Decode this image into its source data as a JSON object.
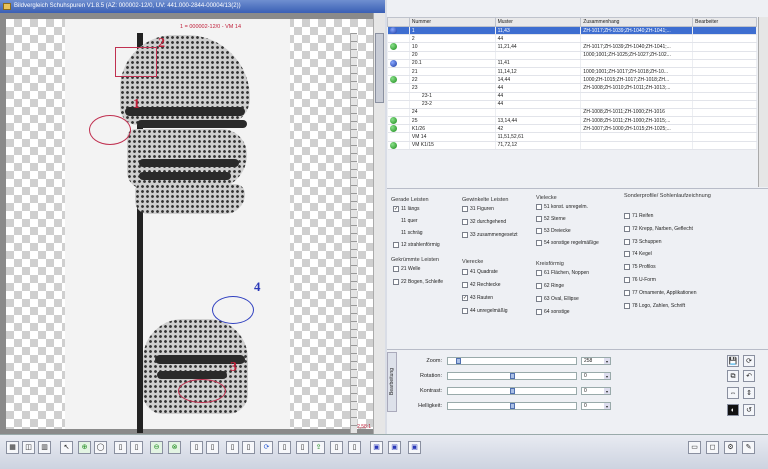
{
  "window": {
    "title": "Bildvergleich Schuhspuren V1.8.5 (AZ: 000002-12/0, UV: 441.000-2844-00004/13(2))"
  },
  "viewer": {
    "header": "1 = 000002-12/0 - VM 14",
    "zoom": "2,58:1",
    "markers": {
      "m1": "1",
      "m2": "2",
      "m3": "3",
      "m4": "4"
    }
  },
  "grid": {
    "columns": [
      "",
      "Nummer",
      "Muster",
      "Zusammenhang",
      "Bearbeiter"
    ],
    "rows": [
      {
        "status": "blue",
        "nummer": "1",
        "muster": "11,43",
        "zusammenhang": "ZH-1017;ZH-1039;ZH-1040;ZH-1041;...",
        "selected": true
      },
      {
        "status": "",
        "nummer": "2",
        "muster": "44",
        "zusammenhang": ""
      },
      {
        "status": "green",
        "nummer": "10",
        "muster": "11,21,44",
        "zusammenhang": "ZH-1017;ZH-1039;ZH-1040;ZH-1041;..."
      },
      {
        "status": "",
        "nummer": "20",
        "muster": "",
        "zusammenhang": "1000;1001;ZH-1025;ZH-1027;ZH-102..."
      },
      {
        "status": "blue",
        "nummer": "20.1",
        "muster": "11,41",
        "zusammenhang": ""
      },
      {
        "status": "",
        "nummer": "21",
        "muster": "11,14,12",
        "zusammenhang": "1000;1001;ZH-1017;ZH-1018;ZH-10..."
      },
      {
        "status": "green",
        "nummer": "22",
        "muster": "14,44",
        "zusammenhang": "1000;ZH-1015;ZH-1017;ZH-1018;ZH..."
      },
      {
        "status": "",
        "nummer": "23",
        "muster": "44",
        "zusammenhang": "ZH-1008;ZH-1010;ZH-1011;ZH-1013;..."
      },
      {
        "status": "",
        "nummer": "23-1",
        "muster": "44",
        "zusammenhang": "",
        "indent": true
      },
      {
        "status": "",
        "nummer": "23-2",
        "muster": "44",
        "zusammenhang": "",
        "indent": true
      },
      {
        "status": "",
        "nummer": "24",
        "muster": "",
        "zusammenhang": "ZH-1008;ZH-1011;ZH-1000;ZH-1016"
      },
      {
        "status": "green",
        "nummer": "25",
        "muster": "13,14,44",
        "zusammenhang": "ZH-1008;ZH-1011;ZH-1000;ZH-1015;..."
      },
      {
        "status": "green",
        "nummer": "K1/26",
        "muster": "42",
        "zusammenhang": "ZH-1007;ZH-1000;ZH-1015;ZH-1025;..."
      },
      {
        "status": "",
        "nummer": "VM 14",
        "muster": "11,51,52,61",
        "zusammenhang": ""
      },
      {
        "status": "green",
        "nummer": "VM K1/15",
        "muster": "71,72,12",
        "zusammenhang": ""
      }
    ]
  },
  "criteria": {
    "gerade": {
      "title": "Gerade Leisten",
      "items": [
        {
          "label": "11 längs",
          "checked": true,
          "box": true
        },
        {
          "label": "11 quer",
          "box": false
        },
        {
          "label": "11 schräg",
          "box": false
        },
        {
          "label": "12 strahlenförmig",
          "box": true
        }
      ]
    },
    "gekruemmt": {
      "title": "Gekrümmte Leisten",
      "items": [
        {
          "label": "21 Welle"
        },
        {
          "label": "22 Bogen, Schleife"
        }
      ]
    },
    "gewinkelt": {
      "title": "Gewinkelte Leisten",
      "items": [
        {
          "label": "31 Figuren"
        },
        {
          "label": "32 durchgehend"
        },
        {
          "label": "33 zusammengesetzt"
        }
      ]
    },
    "vierecke": {
      "title": "Vierecke",
      "items": [
        {
          "label": "41 Quadrate"
        },
        {
          "label": "42 Rechtecke"
        },
        {
          "label": "43 Rauten",
          "checked": true
        },
        {
          "label": "44 unregelmäßig"
        }
      ]
    },
    "vielecke": {
      "title": "Vielecke",
      "items": [
        {
          "label": "51 konst. unregelm."
        },
        {
          "label": "52 Sterne"
        },
        {
          "label": "53 Dreiecke"
        },
        {
          "label": "54 sonstige regelmäßige"
        }
      ]
    },
    "kreis": {
      "title": "Kreisförmig",
      "items": [
        {
          "label": "61 Flächen, Noppen"
        },
        {
          "label": "62 Ringe"
        },
        {
          "label": "63 Oval, Ellipse"
        },
        {
          "label": "64 sonstige"
        }
      ]
    },
    "sonder": {
      "title": "Sonderprofile/ Sohlenlaufzeichnung",
      "items": [
        {
          "label": "71 Reifen"
        },
        {
          "label": "72 Krepp, Narben, Geflecht"
        },
        {
          "label": "73 Schuppen"
        },
        {
          "label": "74 Kegel"
        },
        {
          "label": "75 Profilos"
        },
        {
          "label": "76 U-Form"
        },
        {
          "label": "77 Ornamente, Applikationen"
        },
        {
          "label": "78 Logo, Zahlen, Schrift"
        }
      ]
    }
  },
  "controls": {
    "tab": "Bearbeitung",
    "zoom": {
      "label": "Zoom:",
      "value": "258"
    },
    "rotation": {
      "label": "Rotation:",
      "value": "0"
    },
    "kontrast": {
      "label": "Kontrast:",
      "value": "0"
    },
    "helligkeit": {
      "label": "Helligkeit:",
      "value": "0"
    }
  },
  "icons": [
    "tile-icon",
    "pointer-icon",
    "zoom-icon",
    "plus-icon",
    "minus-icon",
    "close-icon",
    "rotate-icon",
    "save-icon",
    "undo-icon",
    "settings-icon"
  ]
}
